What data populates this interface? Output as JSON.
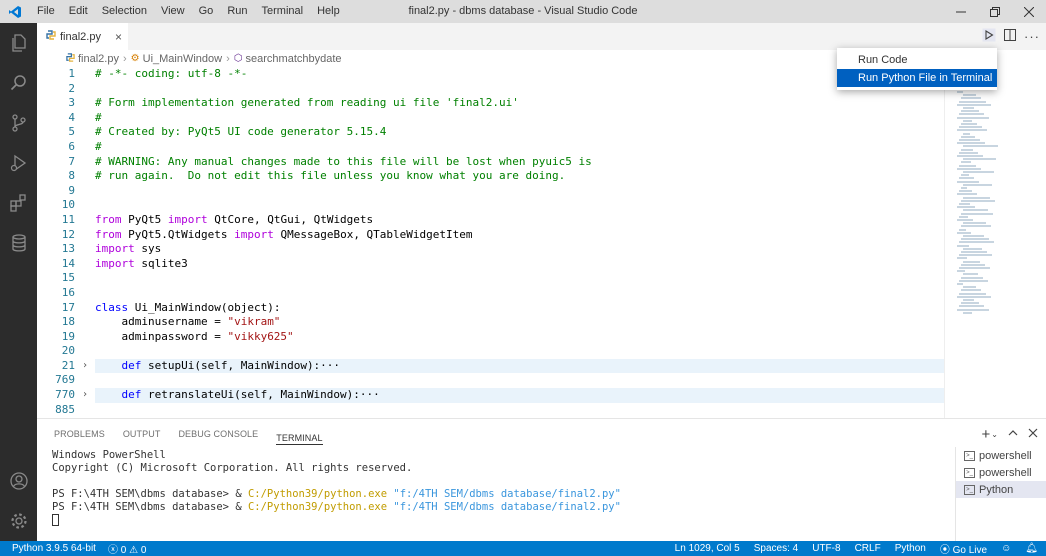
{
  "window": {
    "title": "final2.py - dbms database - Visual Studio Code",
    "menu": [
      "File",
      "Edit",
      "Selection",
      "View",
      "Go",
      "Run",
      "Terminal",
      "Help"
    ]
  },
  "tab": {
    "label": "final2.py",
    "close": "×"
  },
  "breadcrumb": {
    "file": "final2.py",
    "cls": "Ui_MainWindow",
    "method": "searchmatchbydate",
    "sep": "›"
  },
  "dropdown": {
    "items": [
      "Run Code",
      "Run Python File in Terminal"
    ]
  },
  "editor": {
    "lines": [
      {
        "n": "1",
        "text": "# -*- coding: utf-8 -*-"
      },
      {
        "n": "2",
        "text": ""
      },
      {
        "n": "3",
        "text": "# Form implementation generated from reading ui file 'final2.ui'"
      },
      {
        "n": "4",
        "text": "#"
      },
      {
        "n": "5",
        "text": "# Created by: PyQt5 UI code generator 5.15.4"
      },
      {
        "n": "6",
        "text": "#"
      },
      {
        "n": "7",
        "text": "# WARNING: Any manual changes made to this file will be lost when pyuic5 is"
      },
      {
        "n": "8",
        "text": "# run again.  Do not edit this file unless you know what you are doing."
      },
      {
        "n": "9",
        "text": ""
      },
      {
        "n": "10",
        "text": ""
      },
      {
        "n": "11",
        "text": "from PyQt5 import QtCore, QtGui, QtWidgets"
      },
      {
        "n": "12",
        "text": "from PyQt5.QtWidgets import QMessageBox, QTableWidgetItem"
      },
      {
        "n": "13",
        "text": "import sys"
      },
      {
        "n": "14",
        "text": "import sqlite3"
      },
      {
        "n": "15",
        "text": ""
      },
      {
        "n": "16",
        "text": ""
      },
      {
        "n": "17",
        "text": "class Ui_MainWindow(object):"
      },
      {
        "n": "18",
        "text": "    adminusername = \"vikram\""
      },
      {
        "n": "19",
        "text": "    adminpassword = \"vikky625\""
      },
      {
        "n": "20",
        "text": ""
      },
      {
        "n": "21",
        "text": "    def setupUi(self, MainWindow):···"
      },
      {
        "n": "769",
        "text": ""
      },
      {
        "n": "770",
        "text": "    def retranslateUi(self, MainWindow):···"
      },
      {
        "n": "885",
        "text": ""
      }
    ]
  },
  "panel": {
    "tabs": [
      "PROBLEMS",
      "OUTPUT",
      "DEBUG CONSOLE",
      "TERMINAL"
    ],
    "terminal": {
      "line1": "Windows PowerShell",
      "line2": "Copyright (C) Microsoft Corporation. All rights reserved.",
      "prompt": "PS F:\\4TH SEM\\dbms database> & ",
      "exe": "C:/Python39/python.exe",
      "arg": " \"f:/4TH SEM/dbms database/final2.py\""
    },
    "terminals": [
      "powershell",
      "powershell",
      "Python"
    ]
  },
  "statusbar": {
    "python": "Python 3.9.5 64-bit",
    "problems": "ⓧ 0 ⚠ 0",
    "position": "Ln 1029, Col 5",
    "spaces": "Spaces: 4",
    "encoding": "UTF-8",
    "eol": "CRLF",
    "language": "Python",
    "golive": "Go Live"
  }
}
